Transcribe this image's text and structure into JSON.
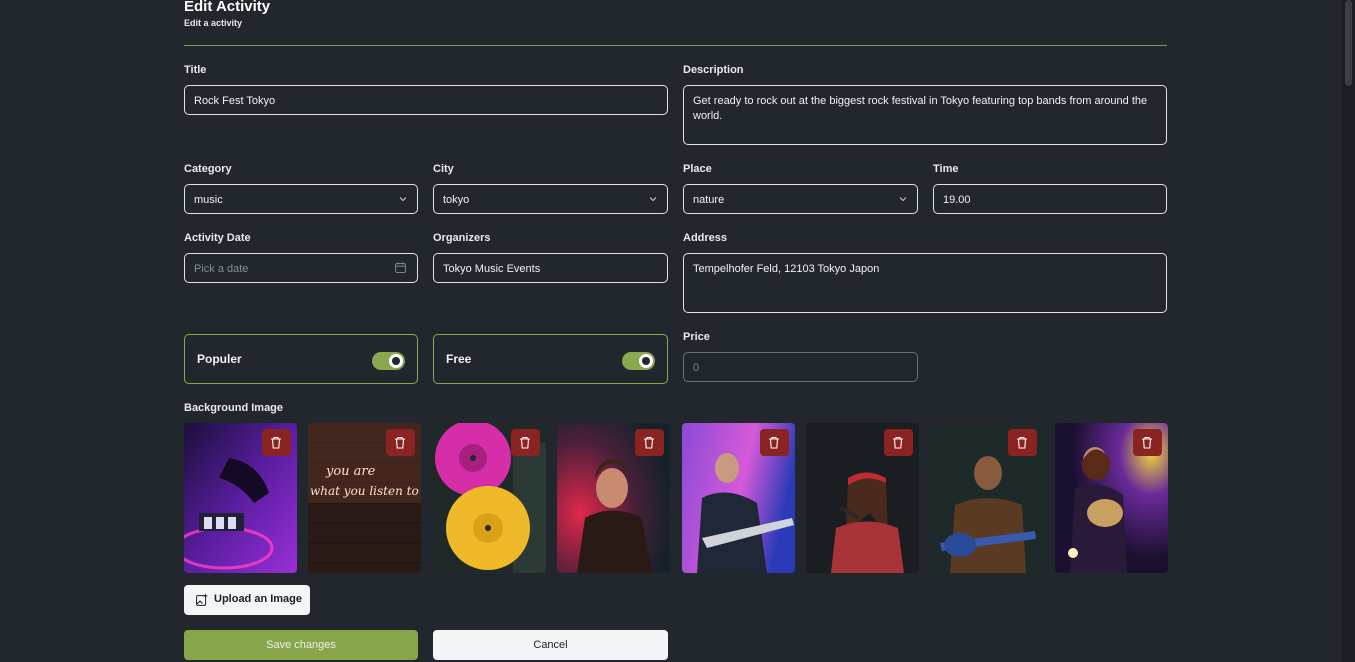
{
  "header": {
    "title": "Edit Activity",
    "subtitle": "Edit a activity"
  },
  "form": {
    "title": {
      "label": "Title",
      "value": "Rock Fest Tokyo"
    },
    "description": {
      "label": "Description",
      "value": "Get ready to rock out at the biggest rock festival in Tokyo featuring top bands from around the world."
    },
    "category": {
      "label": "Category",
      "value": "music"
    },
    "city": {
      "label": "City",
      "value": "tokyo"
    },
    "place": {
      "label": "Place",
      "value": "nature"
    },
    "time": {
      "label": "Time",
      "value": "19.00"
    },
    "activity_date": {
      "label": "Activity Date",
      "placeholder": "Pick a date"
    },
    "organizers": {
      "label": "Organizers",
      "value": "Tokyo Music Events"
    },
    "address": {
      "label": "Address",
      "value": "Tempelhofer Feld, 12103 Tokyo Japon"
    },
    "populer": {
      "label": "Populer",
      "checked": true
    },
    "free": {
      "label": "Free",
      "checked": true
    },
    "price": {
      "label": "Price",
      "value": "0"
    },
    "background_image": {
      "label": "Background Image"
    }
  },
  "images": [
    {
      "name": "dj-turntable",
      "neon_text_1": "",
      "neon_text_2": ""
    },
    {
      "name": "neon-sign",
      "neon_text_1": "you are",
      "neon_text_2": "what you listen to"
    },
    {
      "name": "vinyl-records",
      "neon_text_1": "",
      "neon_text_2": ""
    },
    {
      "name": "singer-guitarist",
      "neon_text_1": "",
      "neon_text_2": ""
    },
    {
      "name": "bass-player",
      "neon_text_1": "",
      "neon_text_2": ""
    },
    {
      "name": "female-singer",
      "neon_text_1": "",
      "neon_text_2": ""
    },
    {
      "name": "acoustic-guitarist",
      "neon_text_1": "",
      "neon_text_2": ""
    },
    {
      "name": "stage-guitarist",
      "neon_text_1": "",
      "neon_text_2": ""
    }
  ],
  "buttons": {
    "upload": "Upload an Image",
    "save": "Save changes",
    "cancel": "Cancel"
  },
  "colors": {
    "background": "#22262d",
    "accent": "#87a54a",
    "danger": "#8b2322"
  }
}
